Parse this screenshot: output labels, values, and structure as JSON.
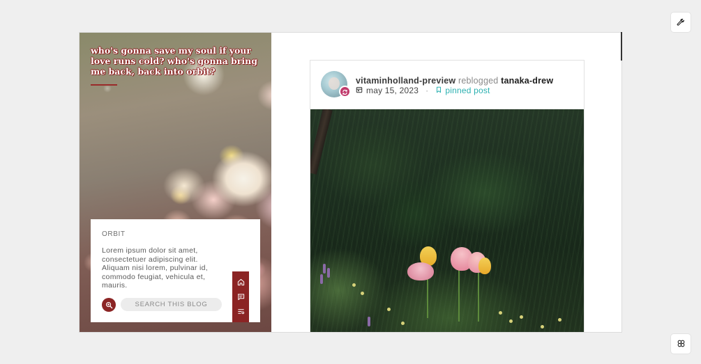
{
  "sidebar": {
    "quote": "who's gonna save my soul if your love runs cold? who's gonna bring me back, back into orbit?",
    "card": {
      "title": "ORBIT",
      "description": "Lorem ipsum dolor sit amet, consectetuer adipiscing elit. Aliquam nisi lorem, pulvinar id, commodo feugiat, vehicula et, mauris.",
      "search_placeholder": "SEARCH THIS BLOG"
    },
    "nav_icons": [
      "home-icon",
      "message-icon",
      "list-settings-icon"
    ]
  },
  "post": {
    "reblogger": "vitaminholland-preview",
    "action": "reblogged",
    "original_author": "tanaka-drew",
    "date": "may 15, 2023",
    "separator": "·",
    "pinned_label": "pinned post"
  },
  "controls": {
    "top_icon": "wrench-icon",
    "bottom_icon": "theme-settings-icon"
  },
  "colors": {
    "accent": "#8b2424",
    "pinned": "#2bb0b0",
    "reblog_badge": "#c0396b"
  }
}
